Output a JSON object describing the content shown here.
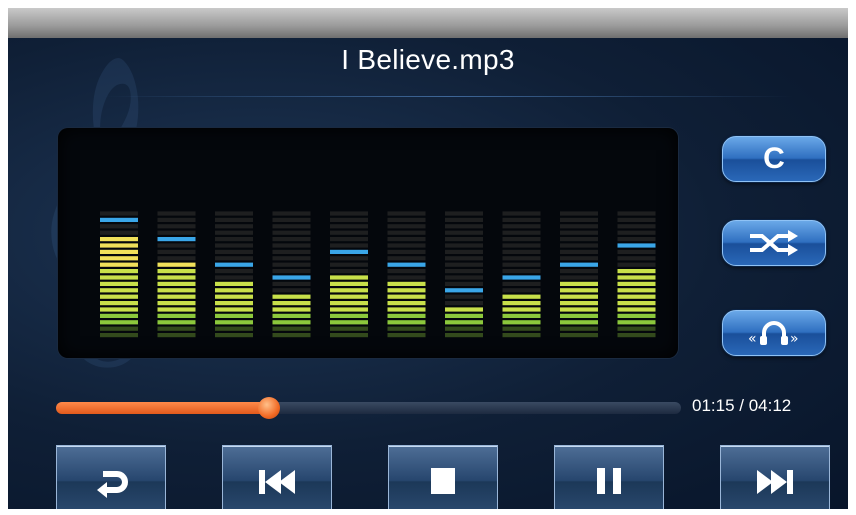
{
  "player": {
    "track_title": "I Believe.mp3",
    "elapsed": "01:15",
    "duration": "04:12",
    "time_display": "01:15 / 04:12",
    "progress_fraction": 0.34
  },
  "equalizer": {
    "band_count": 10,
    "segments_per_band": 16,
    "band_levels": [
      16,
      12,
      9,
      7,
      10,
      9,
      5,
      7,
      9,
      11
    ],
    "peak_levels": [
      18,
      15,
      11,
      9,
      13,
      11,
      7,
      9,
      11,
      14
    ],
    "colors": {
      "high": "#f0e05a",
      "mid": "#c8e04a",
      "low": "#8cc83c",
      "peak": "#3aa6e8",
      "off": "#2a2a2a"
    }
  },
  "side_buttons": {
    "eq_preset_label": "C",
    "shuffle_icon": "shuffle-icon",
    "surround_icon": "surround-headphone-icon"
  },
  "controls": [
    {
      "icon": "repeat-icon"
    },
    {
      "icon": "previous-track-icon"
    },
    {
      "icon": "stop-icon"
    },
    {
      "icon": "pause-icon"
    },
    {
      "icon": "next-track-icon"
    }
  ],
  "theme": {
    "accent": "#f26a24",
    "button_blue": "#2f6fc0"
  }
}
